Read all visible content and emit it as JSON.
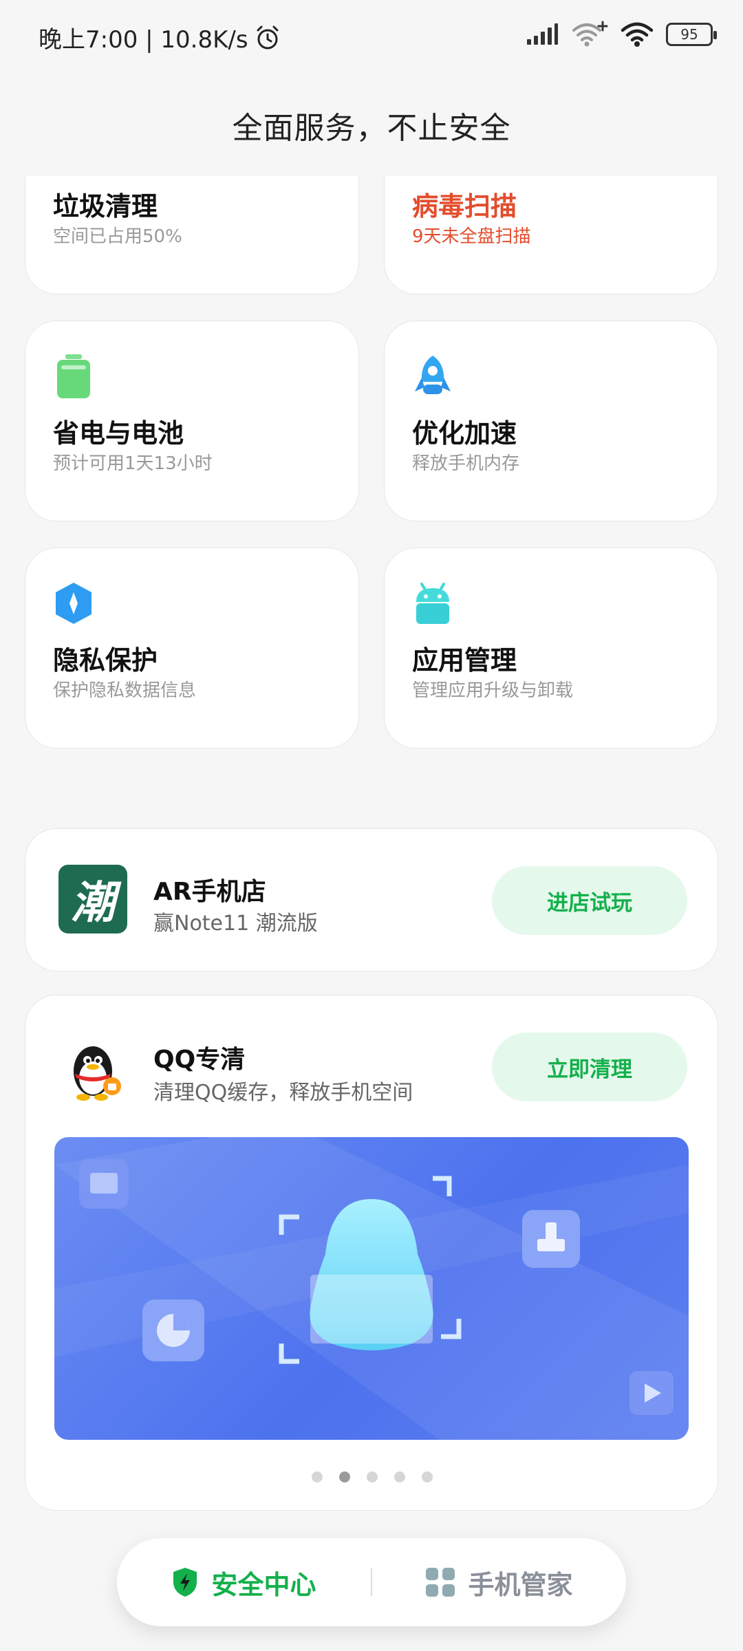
{
  "status_bar": {
    "time_speed": "晚上7:00 | 10.8K/s",
    "battery": "95"
  },
  "page": {
    "title": "全面服务，不止安全"
  },
  "cards": [
    {
      "icon": "trash-icon",
      "title": "垃圾清理",
      "subtitle": "空间已占用50%"
    },
    {
      "icon": "virus-scan-icon",
      "title": "病毒扫描",
      "subtitle": "9天未全盘扫描",
      "alert": true
    },
    {
      "icon": "battery-icon",
      "title": "省电与电池",
      "subtitle": "预计可用1天13小时"
    },
    {
      "icon": "rocket-icon",
      "title": "优化加速",
      "subtitle": "释放手机内存"
    },
    {
      "icon": "privacy-shield-icon",
      "title": "隐私保护",
      "subtitle": "保护隐私数据信息"
    },
    {
      "icon": "android-icon",
      "title": "应用管理",
      "subtitle": "管理应用升级与卸载"
    }
  ],
  "ar_store": {
    "logo_text": "潮",
    "title": "AR手机店",
    "subtitle": "赢Note11 潮流版",
    "button": "进店试玩"
  },
  "qq_clean": {
    "title": "QQ专清",
    "subtitle": "清理QQ缓存，释放手机空间",
    "button": "立即清理",
    "carousel_index": 2,
    "carousel_count": 5
  },
  "bottom_nav": {
    "security_center": "安全中心",
    "phone_manager": "手机管家"
  },
  "colors": {
    "accent_green": "#13b04b",
    "alert_red": "#e34d2c",
    "banner_blue": "#5277ee"
  }
}
